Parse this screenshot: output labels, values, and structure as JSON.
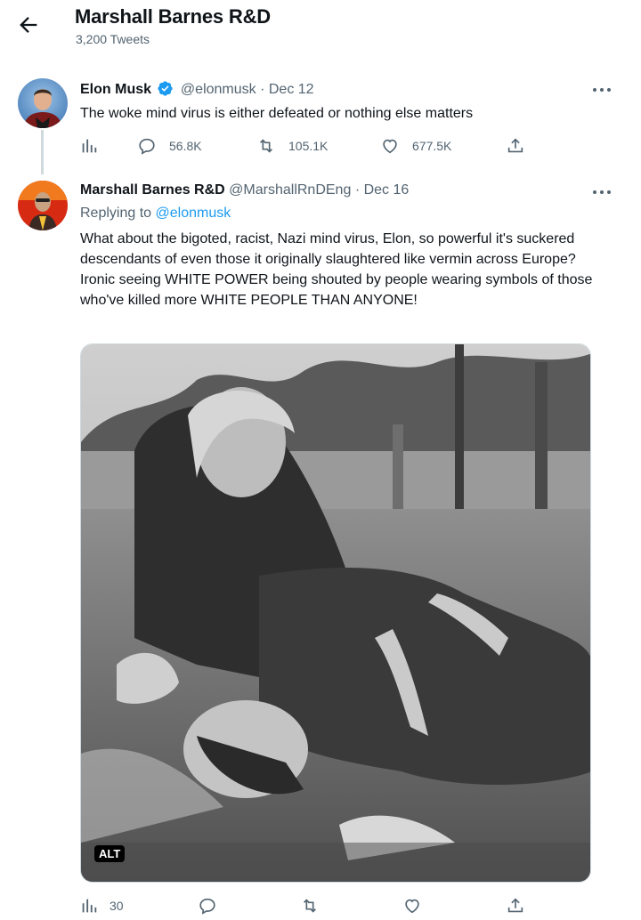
{
  "header": {
    "title": "Marshall Barnes R&D",
    "tweet_count": "3,200 Tweets"
  },
  "original_tweet": {
    "name": "Elon Musk",
    "handle": "@elonmusk",
    "separator": "·",
    "date": "Dec 12",
    "verified": true,
    "text": "The woke mind virus is either defeated or nothing else matters",
    "stats": {
      "views": "56.8K",
      "retweets": "105.1K",
      "likes": "677.5K"
    }
  },
  "reply_tweet": {
    "name": "Marshall Barnes R&D",
    "handle": "@MarshallRnDEng",
    "separator": "·",
    "date": "Dec 16",
    "replying_to_label": "Replying to",
    "replying_to_handle": "@elonmusk",
    "text": "What about the bigoted, racist, Nazi mind virus, Elon, so powerful it's suckered descendants of even those it originally slaughtered like vermin across Europe? Ironic seeing WHITE POWER being shouted by people wearing symbols of those who've killed more WHITE PEOPLE THAN ANYONE!",
    "media_alt_badge": "ALT",
    "stats": {
      "views": "30"
    }
  },
  "colors": {
    "accent": "#1d9bf0",
    "secondary_text": "#536471",
    "divider": "#cfd9de"
  },
  "icons": [
    "back-arrow-icon",
    "verified-badge-icon",
    "more-icon",
    "analytics-icon",
    "reply-icon",
    "retweet-icon",
    "like-icon",
    "share-icon"
  ]
}
